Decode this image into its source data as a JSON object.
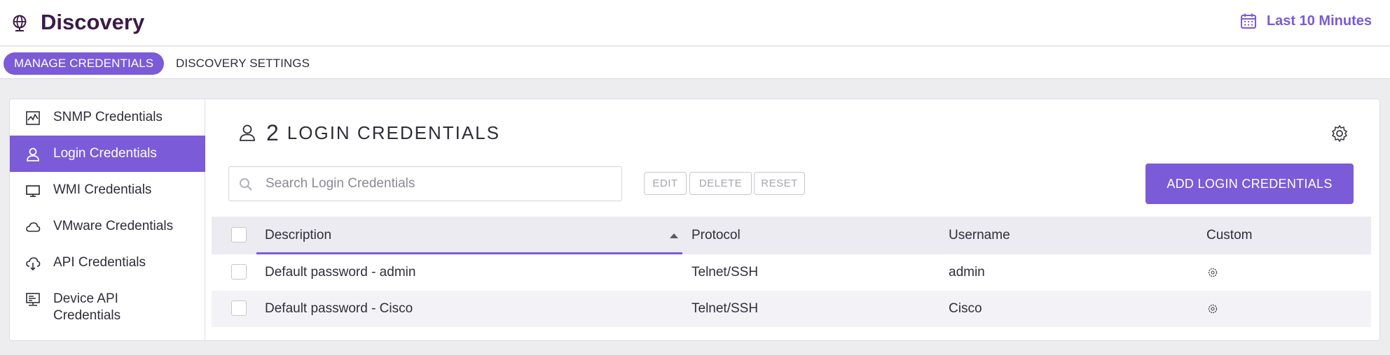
{
  "header": {
    "title": "Discovery",
    "time_range": "Last 10 Minutes"
  },
  "tabs": [
    {
      "label": "MANAGE CREDENTIALS",
      "active": true
    },
    {
      "label": "DISCOVERY SETTINGS",
      "active": false
    }
  ],
  "sidebar": {
    "items": [
      {
        "label": "SNMP Credentials",
        "icon": "activity-chart-icon"
      },
      {
        "label": "Login Credentials",
        "icon": "user-icon",
        "active": true
      },
      {
        "label": "WMI Credentials",
        "icon": "monitor-icon"
      },
      {
        "label": "VMware Credentials",
        "icon": "cloud-icon"
      },
      {
        "label": "API Credentials",
        "icon": "cloud-download-icon"
      },
      {
        "label": "Device API Credentials",
        "icon": "device-api-icon"
      }
    ]
  },
  "main": {
    "count": "2",
    "heading": "LOGIN CREDENTIALS",
    "search_placeholder": "Search Login Credentials",
    "buttons": {
      "edit": "EDIT",
      "delete": "DELETE",
      "reset": "RESET",
      "add": "ADD LOGIN CREDENTIALS"
    },
    "columns": [
      "Description",
      "Protocol",
      "Username",
      "Custom"
    ],
    "sorted_column": "Description",
    "sort_direction": "ascending",
    "rows": [
      {
        "description": "Default password - admin",
        "protocol": "Telnet/SSH",
        "username": "admin",
        "custom_icon": "gear-badge-icon"
      },
      {
        "description": "Default password - Cisco",
        "protocol": "Telnet/SSH",
        "username": "Cisco",
        "custom_icon": "gear-badge-icon"
      }
    ]
  },
  "colors": {
    "accent": "#7b5bd8",
    "title": "#3b1a47",
    "time_link": "#7a5ad6"
  }
}
